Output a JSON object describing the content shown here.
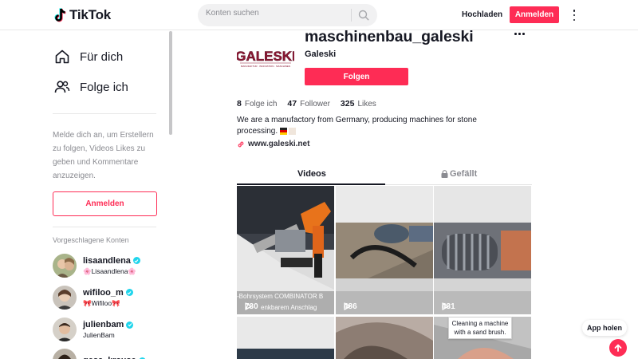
{
  "header": {
    "logo_text": "TikTok",
    "search_placeholder": "Konten suchen",
    "upload_label": "Hochladen",
    "login_label": "Anmelden"
  },
  "sidebar": {
    "nav": [
      {
        "label": "Für dich",
        "icon": "home-icon"
      },
      {
        "label": "Folge ich",
        "icon": "following-icon"
      }
    ],
    "login_hint": "Melde dich an, um Erstellern zu folgen, Videos Likes zu geben und Kommentare anzuzeigen.",
    "login_button": "Anmelden",
    "suggested_title": "Vorgeschlagene Konten",
    "accounts": [
      {
        "username": "lisaandlena",
        "nickname": "🌸Lisaandlena🌸",
        "verified": true
      },
      {
        "username": "wifiloo_m",
        "nickname": "🎀Wifiloo🎀",
        "verified": true
      },
      {
        "username": "julienbam",
        "nickname": "JulienBam",
        "verified": true
      },
      {
        "username": "gesa_krause",
        "nickname": "",
        "verified": true
      }
    ]
  },
  "profile": {
    "logo_text": "GALESKI",
    "logo_tagline": "MANUFAKTUR · INNOVATION · MASCHINEN",
    "username": "maschinenbau_galeski",
    "nickname": "Galeski",
    "follow_label": "Folgen",
    "stats": [
      {
        "value": "8",
        "label": "Folge ich"
      },
      {
        "value": "47",
        "label": "Follower"
      },
      {
        "value": "325",
        "label": "Likes"
      }
    ],
    "bio": "We are a manufactory from Germany, producing machines for stone processing.",
    "link": "www.galeski.net"
  },
  "tabs": {
    "videos": "Videos",
    "liked": "Gefällt"
  },
  "videos": [
    {
      "views": "730",
      "caption": "-Bohrsystem COMBINATOR B",
      "caption2": "enkbarem Anschlag"
    },
    {
      "views": "486"
    },
    {
      "views": "431"
    }
  ],
  "tooltip": "Cleaning a machine with a sand brush.",
  "get_app_label": "App holen",
  "colors": {
    "accent": "#fe2c55",
    "verified": "#20d5ec",
    "text": "#161823",
    "muted": "#8a8b91"
  }
}
